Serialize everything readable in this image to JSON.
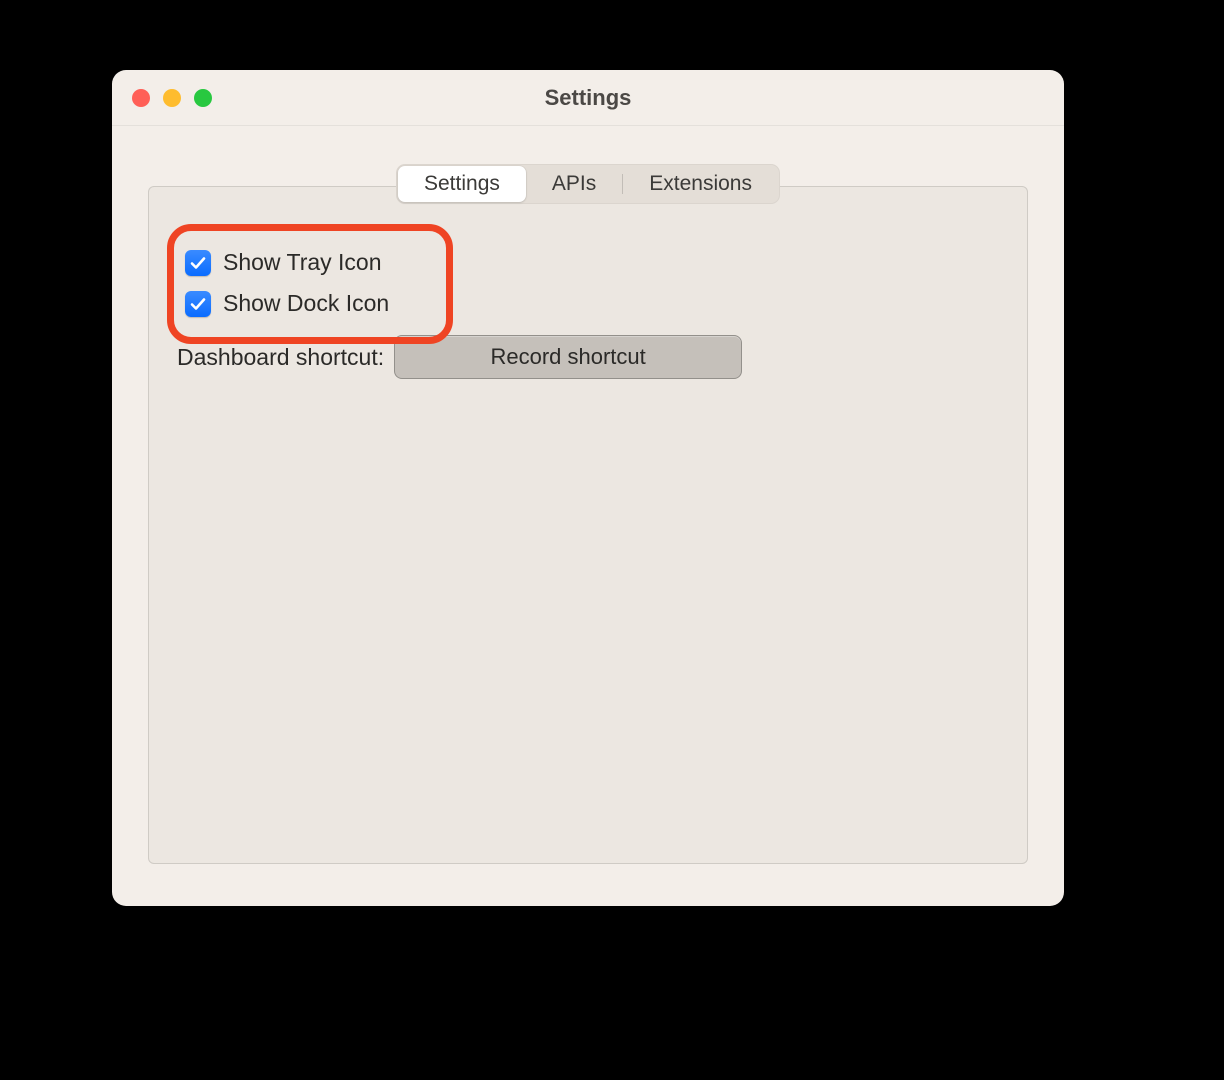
{
  "window": {
    "title": "Settings"
  },
  "tabs": [
    {
      "label": "Settings",
      "active": true
    },
    {
      "label": "APIs",
      "active": false
    },
    {
      "label": "Extensions",
      "active": false
    }
  ],
  "options": {
    "show_tray_icon": {
      "label": "Show Tray Icon",
      "checked": true
    },
    "show_dock_icon": {
      "label": "Show Dock Icon",
      "checked": true
    }
  },
  "shortcut": {
    "label": "Dashboard shortcut:",
    "button_label": "Record shortcut"
  }
}
